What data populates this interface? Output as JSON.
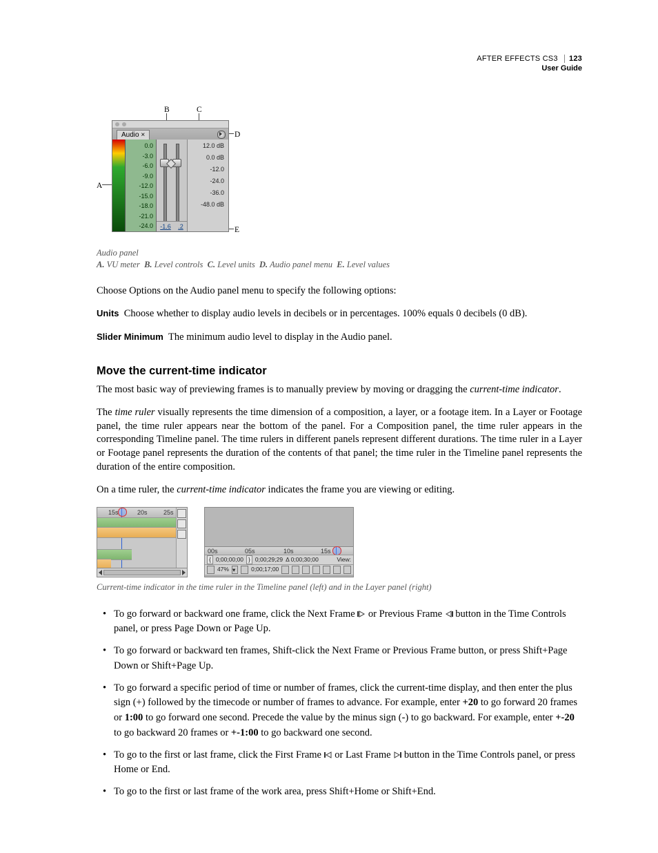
{
  "header": {
    "product": "AFTER EFFECTS CS3",
    "subtitle": "User Guide",
    "page_number": "123"
  },
  "fig1": {
    "panel_tab": "Audio  ×",
    "scale_values": [
      "0.0",
      "-3.0",
      "-6.0",
      "-9.0",
      "-12.0",
      "-15.0",
      "-18.0",
      "-21.0",
      "-24.0"
    ],
    "level_values": [
      "12.0 dB",
      "0.0 dB",
      "-12.0",
      "-24.0",
      "-36.0",
      "-48.0 dB"
    ],
    "readout_left": "-1.6",
    "readout_right": ".2",
    "callouts": {
      "A": "A",
      "B": "B",
      "C": "C",
      "D": "D",
      "E": "E"
    },
    "caption_title": "Audio panel",
    "caption_legend": {
      "A": "VU meter",
      "B": "Level controls",
      "C": "Level units",
      "D": "Audio panel menu",
      "E": "Level values"
    }
  },
  "intro": {
    "p1": "Choose Options on the Audio panel menu to specify the following options:",
    "units_label": "Units",
    "units_text": "Choose whether to display audio levels in decibels or in percentages. 100% equals 0 decibels (0 dB).",
    "slidermin_label": "Slider Minimum",
    "slidermin_text": "The minimum audio level to display in the Audio panel."
  },
  "section": {
    "heading": "Move the current-time indicator",
    "p1_a": "The most basic way of previewing frames is to manually preview by moving or dragging the ",
    "p1_em": "current-time indicator",
    "p1_b": ".",
    "p2_a": "The ",
    "p2_em": "time ruler",
    "p2_b": " visually represents the time dimension of a composition, a layer, or a footage item. In a Layer or Footage panel, the time ruler appears near the bottom of the panel. For a Composition panel, the time ruler appears in the corresponding Timeline panel. The time rulers in different panels represent different durations. The time ruler in a Layer or Footage panel represents the duration of the contents of that panel; the time ruler in the Timeline panel represents the duration of the entire composition.",
    "p3_a": "On a time ruler, the ",
    "p3_em": "current-time indicator",
    "p3_b": " indicates the frame you are viewing or editing."
  },
  "fig2": {
    "timeline_ticks": [
      "15s",
      "20s",
      "25s"
    ],
    "layer_ticks": [
      "00s",
      "05s",
      "10s",
      "15s"
    ],
    "layer_tc": {
      "in": "0;00;00;00",
      "out": "0;00;29;29",
      "dur": "Δ 0;00;30;00",
      "view": "View:"
    },
    "layer_row2": {
      "zoom": "47%",
      "time": "0;00;17;00"
    },
    "caption": "Current-time indicator in the time ruler in the Timeline panel (left) and in the Layer panel (right)"
  },
  "bullets": {
    "b1_a": "To go forward or backward one frame, click the Next Frame ",
    "b1_b": " or Previous Frame ",
    "b1_c": " button in the Time Controls panel, or press Page Down or Page Up.",
    "b2": "To go forward or backward ten frames, Shift-click the Next Frame or Previous Frame button, or press Shift+Page Down or Shift+Page Up.",
    "b3_a": "To go forward a specific period of time or number of frames, click the current-time display, and then enter the plus sign (+) followed by the timecode or number of frames to advance. For example, enter ",
    "b3_s1": "+20",
    "b3_b": " to go forward 20 frames or ",
    "b3_s2": "1:00",
    "b3_c": " to go forward one second. Precede the value by the minus sign (-) to go backward. For example, enter ",
    "b3_s3": "+-20",
    "b3_d": " to go backward 20 frames or ",
    "b3_s4": "+-1:00",
    "b3_e": " to go backward one second.",
    "b4_a": "To go to the first or last frame, click the First Frame ",
    "b4_b": " or Last Frame ",
    "b4_c": " button in the Time Controls panel, or press Home or End.",
    "b5": "To go to the first or last frame of the work area, press Shift+Home or Shift+End."
  }
}
